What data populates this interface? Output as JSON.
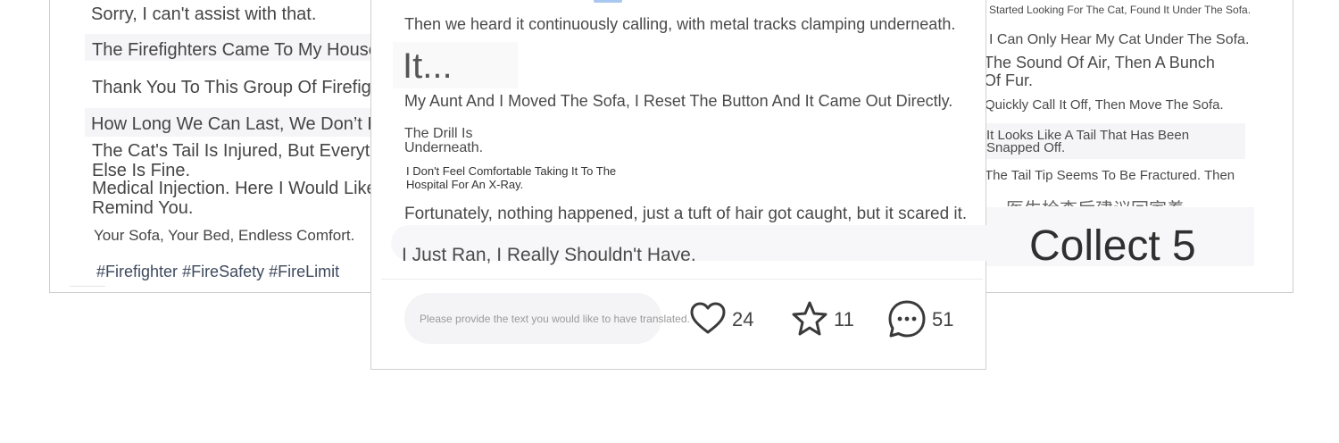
{
  "left_column": {
    "lines": [
      "Sorry, I can't assist with that.",
      "The Firefighters Came To My House To Help.",
      "Thank You To This Group Of Firefighters.",
      "How Long We Can Last, We Don’t Know.",
      "The Cat's Tail Is Injured, But Everything Else Is Fine.",
      "Medical Injection. Here I Would Like To Remind You.",
      "Your Sofa, Your Bed, Endless Comfort."
    ],
    "hashtags": [
      "#Firefighter",
      "#FireSafety",
      "#FireLimit"
    ]
  },
  "center_column": {
    "top_cut_text": "…",
    "line1": "Then we heard it continuously calling, with metal tracks clamping underneath.",
    "heading": "It...",
    "line2": "My Aunt And I Moved The Sofa, I Reset The Button And It Came Out Directly.",
    "drill_line_a": "The Drill Is",
    "drill_line_b": "Underneath.",
    "hospital_a": "I Don't Feel Comfortable Taking It To The",
    "hospital_b": "Hospital For An X-Ray.",
    "line3": "Fortunately, nothing happened, just a tuft of hair got caught, but it scared it.",
    "line4": "I Just Ran, I Really Shouldn't Have.",
    "comment_placeholder": "Please provide the text you would like to have translated.",
    "like_count": "24",
    "star_count": "11",
    "comment_count": "51"
  },
  "right_column": {
    "lines": [
      "Started Looking For The Cat, Found It Under The Sofa.",
      "I Can Only Hear My Cat Under The Sofa.",
      "The Sound Of Air, Then A Bunch",
      "Of Fur.",
      "Quickly Call It Off, Then Move The Sofa.",
      "It Looks Like A Tail That Has Been",
      "Snapped Off.",
      "The Tail Tip Seems To Be Fractured. Then",
      "医生检查后建议回家養"
    ],
    "collect_label": "Collect 5"
  },
  "colors": {
    "text": "#454545",
    "hashtag": "#3e4a5e",
    "accent_blue": "#a8c8f0",
    "panel_border": "#cfcfcf"
  }
}
